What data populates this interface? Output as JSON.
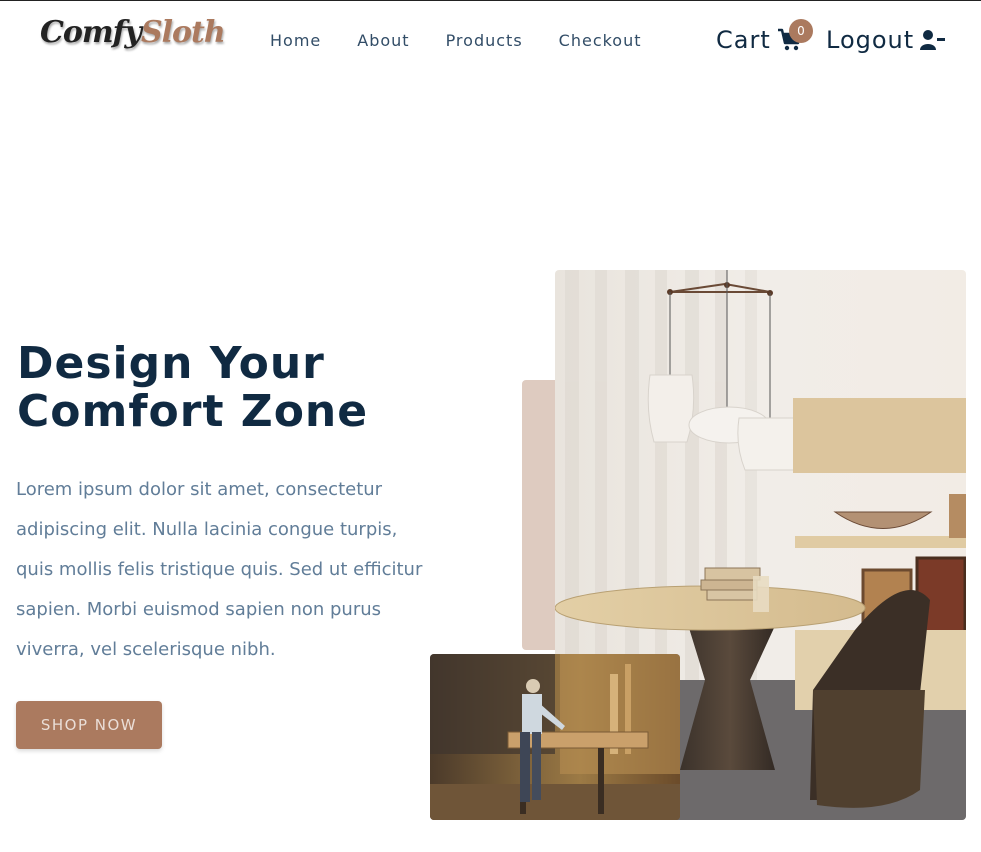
{
  "brand": {
    "name_part1": "Comfy",
    "name_part2": "Sloth"
  },
  "nav": {
    "links": [
      "Home",
      "About",
      "Products",
      "Checkout"
    ],
    "cart_label": "Cart",
    "cart_count": "0",
    "logout_label": "Logout"
  },
  "hero": {
    "title_line1": "Design Your",
    "title_line2": "Comfort Zone",
    "text": "Lorem ipsum dolor sit amet, consectetur adipiscing elit. Nulla lacinia congue turpis, quis mollis felis tristique quis. Sed ut efficitur sapien. Morbi euismod sapien non purus viverra, vel scelerisque nibh.",
    "cta_label": "SHOP NOW"
  },
  "colors": {
    "primary": "#ab7a5f",
    "heading": "#102a42",
    "body_text": "#617d98",
    "accent_block": "#decbc0"
  },
  "icons": {
    "cart": "shopping-cart-icon",
    "logout": "user-minus-icon"
  }
}
